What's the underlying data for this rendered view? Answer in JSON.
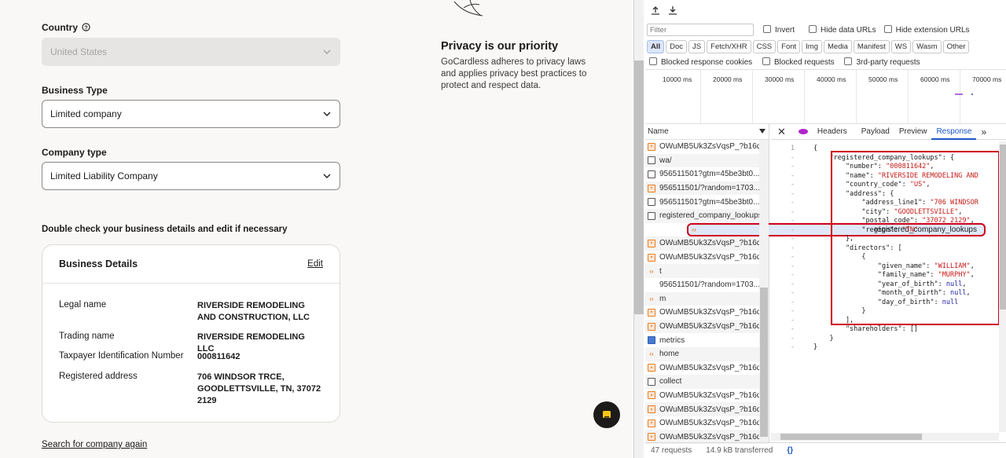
{
  "form": {
    "country_label": "Country",
    "country_value": "United States",
    "business_type_label": "Business Type",
    "business_type_value": "Limited company",
    "company_type_label": "Company type",
    "company_type_value": "Limited Liability Company",
    "double_check_text": "Double check your business details and edit if necessary",
    "card": {
      "title": "Business Details",
      "edit_label": "Edit",
      "rows": [
        {
          "label": "Legal name",
          "value": "RIVERSIDE REMODELING AND CONSTRUCTION, LLC"
        },
        {
          "label": "Trading name",
          "value": "RIVERSIDE REMODELING LLC"
        },
        {
          "label": "Taxpayer Identification Number",
          "value": "000811642"
        },
        {
          "label": "Registered address",
          "value": "706 WINDSOR TRCE, GOODLETTSVILLE, TN, 37072 2129"
        }
      ]
    },
    "search_again": "Search for company again"
  },
  "privacy": {
    "title": "Privacy is our priority",
    "body": "GoCardless adheres to privacy laws and applies privacy best practices to protect and respect data."
  },
  "devtools": {
    "filter_placeholder": "Filter",
    "invert": "Invert",
    "hide_data_urls": "Hide data URLs",
    "hide_extension_urls": "Hide extension URLs",
    "types": [
      "All",
      "Doc",
      "JS",
      "Fetch/XHR",
      "CSS",
      "Font",
      "Img",
      "Media",
      "Manifest",
      "WS",
      "Wasm",
      "Other"
    ],
    "blocked_cookies": "Blocked response cookies",
    "blocked_requests": "Blocked requests",
    "third_party": "3rd-party requests",
    "ticks": [
      "10000 ms",
      "20000 ms",
      "30000 ms",
      "40000 ms",
      "50000 ms",
      "60000 ms",
      "70000 ms"
    ],
    "name_header": "Name",
    "requests": [
      {
        "icon": "img",
        "name": "OWuMB5Uk3ZsVqsP_?b16d..."
      },
      {
        "icon": "doc",
        "name": "wa/"
      },
      {
        "icon": "blank-doc",
        "name": "956511501?gtm=45be3bt0..."
      },
      {
        "icon": "img",
        "name": "956511501/?random=1703..."
      },
      {
        "icon": "blank-doc",
        "name": "956511501?gtm=45be3bt0..."
      },
      {
        "icon": "blank-doc",
        "name": "registered_company_lookups"
      },
      {
        "icon": "xhr",
        "name": "registered_company_lookups"
      },
      {
        "icon": "img",
        "name": "OWuMB5Uk3ZsVqsP_?b16d..."
      },
      {
        "icon": "img",
        "name": "OWuMB5Uk3ZsVqsP_?b16d..."
      },
      {
        "icon": "xhr",
        "name": "t"
      },
      {
        "icon": "none",
        "name": "956511501/?random=1703..."
      },
      {
        "icon": "xhr",
        "name": "m"
      },
      {
        "icon": "img",
        "name": "OWuMB5Uk3ZsVqsP_?b16d..."
      },
      {
        "icon": "img",
        "name": "OWuMB5Uk3ZsVqsP_?b16d..."
      },
      {
        "icon": "metrics",
        "name": "metrics"
      },
      {
        "icon": "xhr",
        "name": "home"
      },
      {
        "icon": "img",
        "name": "OWuMB5Uk3ZsVqsP_?b16d..."
      },
      {
        "icon": "doc",
        "name": "collect"
      },
      {
        "icon": "img",
        "name": "OWuMB5Uk3ZsVqsP_?b16d..."
      },
      {
        "icon": "img",
        "name": "OWuMB5Uk3ZsVqsP_?b16d..."
      },
      {
        "icon": "img",
        "name": "OWuMB5Uk3ZsVqsP_?b16d..."
      },
      {
        "icon": "img",
        "name": "OWuMB5Uk3ZsVqsP_?b16d..."
      }
    ],
    "tabs": [
      "Headers",
      "Payload",
      "Preview",
      "Response"
    ],
    "active_tab": "Response",
    "status": {
      "requests": "47 requests",
      "transferred": "14.9 kB transferred"
    },
    "response_lines": [
      {
        "gutter": "1",
        "text": "{"
      },
      {
        "gutter": "-",
        "text": "    \"registered_company_lookups\": {"
      },
      {
        "gutter": "-",
        "text": "        \"number\": \"000811642\","
      },
      {
        "gutter": "-",
        "text": "        \"name\": \"RIVERSIDE REMODELING AND"
      },
      {
        "gutter": "-",
        "text": "        \"country_code\": \"US\","
      },
      {
        "gutter": "-",
        "text": "        \"address\": {"
      },
      {
        "gutter": "-",
        "text": "            \"address_line1\": \"706 WINDSOR"
      },
      {
        "gutter": "-",
        "text": "            \"city\": \"GOODLETTSVILLE\","
      },
      {
        "gutter": "-",
        "text": "            \"postal_code\": \"37072 2129\","
      },
      {
        "gutter": "-",
        "text": "            \"region\": \"TN\""
      },
      {
        "gutter": "-",
        "text": "        },"
      },
      {
        "gutter": "-",
        "text": "        \"directors\": ["
      },
      {
        "gutter": "-",
        "text": "            {"
      },
      {
        "gutter": "-",
        "text": "                \"given_name\": \"WILLIAM\","
      },
      {
        "gutter": "-",
        "text": "                \"family_name\": \"MURPHY\","
      },
      {
        "gutter": "-",
        "text": "                \"year_of_birth\": null,"
      },
      {
        "gutter": "-",
        "text": "                \"month_of_birth\": null,"
      },
      {
        "gutter": "-",
        "text": "                \"day_of_birth\": null"
      },
      {
        "gutter": "-",
        "text": "            }"
      },
      {
        "gutter": "-",
        "text": "        ],"
      },
      {
        "gutter": "-",
        "text": "        \"shareholders\": []"
      },
      {
        "gutter": "-",
        "text": "    }"
      },
      {
        "gutter": "-",
        "text": "}"
      }
    ]
  }
}
